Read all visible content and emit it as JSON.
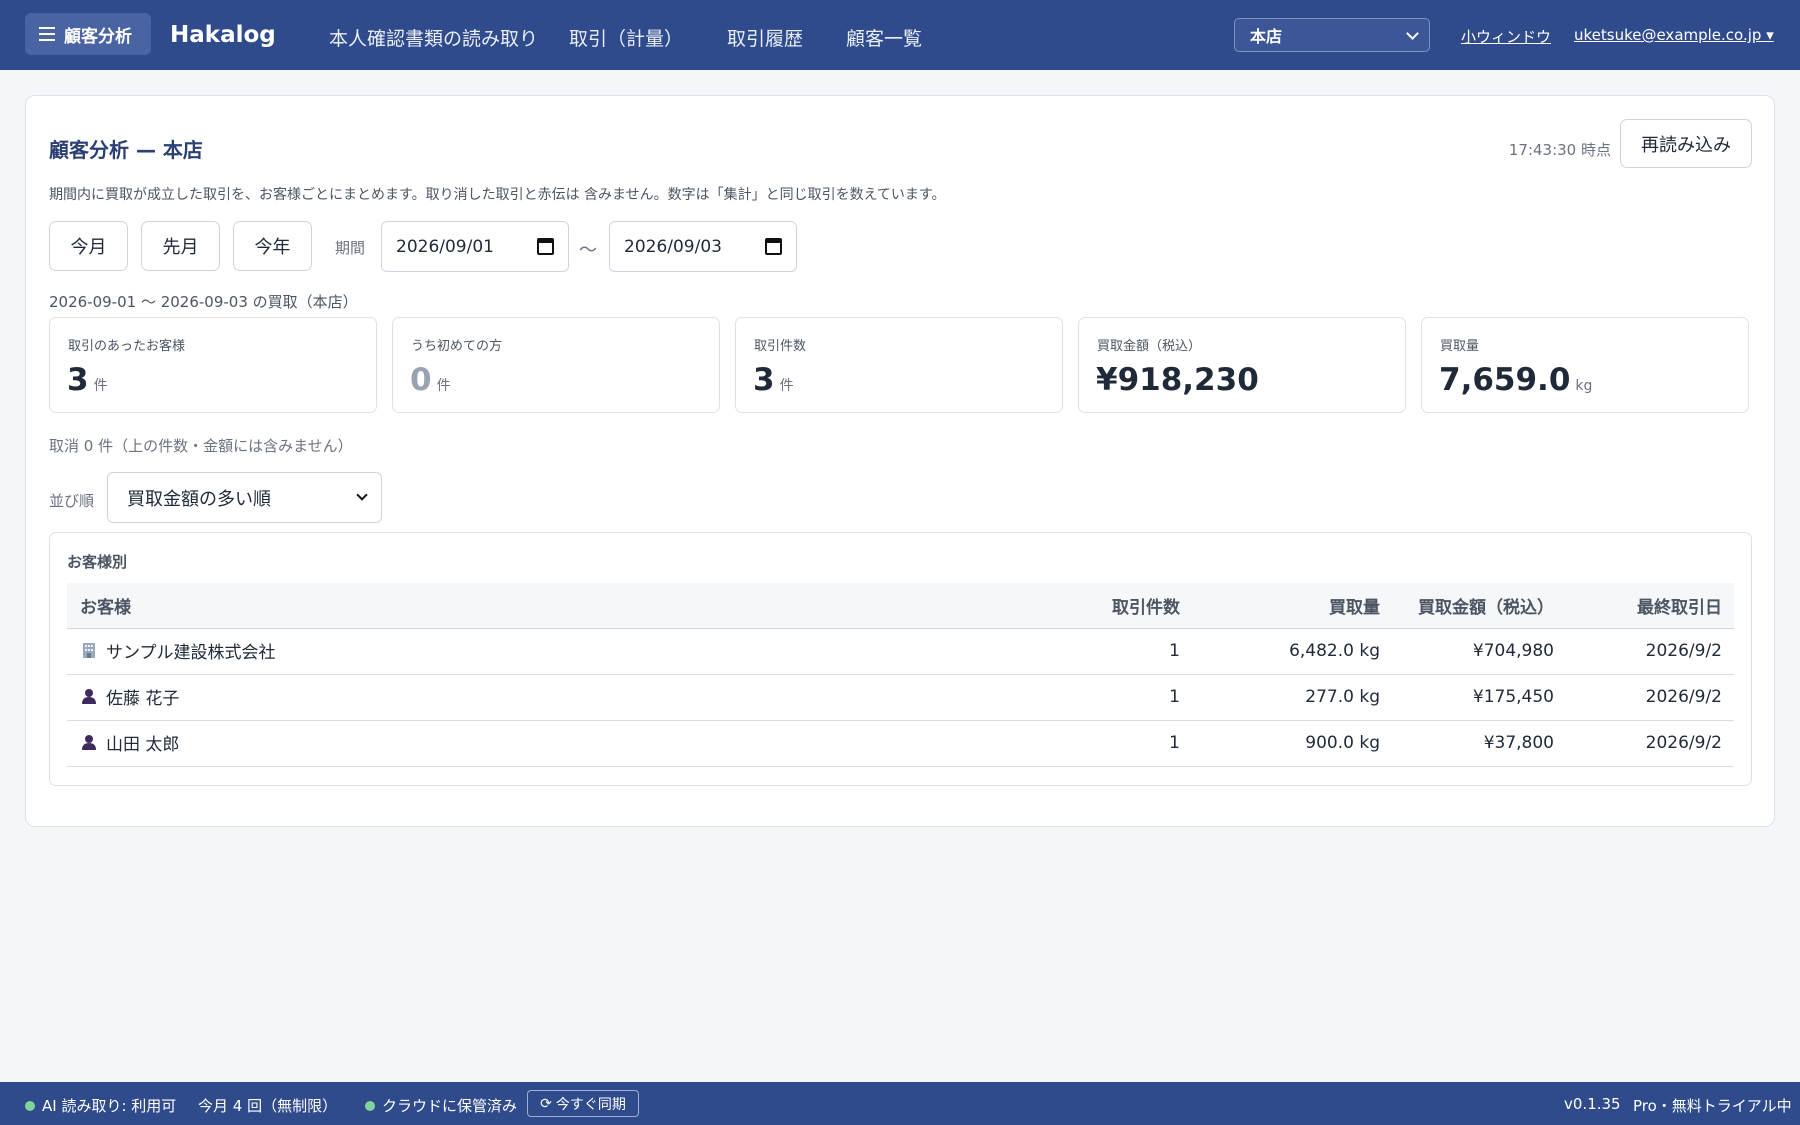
{
  "nav": {
    "menu_label": "顧客分析",
    "brand": "Hakalog",
    "links": [
      "本人確認書類の読み取り",
      "取引（計量）",
      "取引履歴",
      "顧客一覧"
    ],
    "store": "本店",
    "mini_window": "小ウィンドウ",
    "user": "uketsuke@example.co.jp ▾"
  },
  "header": {
    "title": "顧客分析 — 本店",
    "timestamp": "17:43:30 時点",
    "reload": "再読み込み",
    "description": "期間内に買取が成立した取引を、お客様ごとにまとめます。取り消した取引と赤伝は 含みません。数字は「集計」と同じ取引を数えています。"
  },
  "period": {
    "quick": [
      "今月",
      "先月",
      "今年"
    ],
    "label": "期間",
    "from": "2026/09/01",
    "to": "2026/09/03",
    "separator": "〜",
    "caption": "2026-09-01 〜 2026-09-03 の買取（本店）"
  },
  "kpis": [
    {
      "label": "取引のあったお客様",
      "value": "3",
      "unit": "件"
    },
    {
      "label": "うち初めての方",
      "value": "0",
      "unit": "件"
    },
    {
      "label": "取引件数",
      "value": "3",
      "unit": "件"
    },
    {
      "label": "買取金額（税込）",
      "value": "¥918,230",
      "unit": ""
    },
    {
      "label": "買取量",
      "value": "7,659.0",
      "unit": "kg"
    }
  ],
  "cancel_note": "取消 0 件（上の件数・金額には含みません）",
  "sort": {
    "label": "並び順",
    "value": "買取金額の多い順"
  },
  "table": {
    "title": "お客様別",
    "headers": [
      "お客様",
      "取引件数",
      "買取量",
      "買取金額（税込）",
      "最終取引日"
    ],
    "rows": [
      {
        "icon": "building-icon",
        "name": "サンプル建設株式会社",
        "count": "1",
        "weight": "6,482.0 kg",
        "amount": "¥704,980",
        "last": "2026/9/2"
      },
      {
        "icon": "person-icon",
        "name": "佐藤 花子",
        "count": "1",
        "weight": "277.0 kg",
        "amount": "¥175,450",
        "last": "2026/9/2"
      },
      {
        "icon": "person-icon",
        "name": "山田 太郎",
        "count": "1",
        "weight": "900.0 kg",
        "amount": "¥37,800",
        "last": "2026/9/2"
      }
    ]
  },
  "status": {
    "ai": "AI 読み取り: 利用可",
    "monthly": "今月 4 回（無制限）",
    "cloud": "クラウドに保管済み",
    "sync": "今すぐ同期",
    "version": "v0.1.35",
    "plan": "Pro・無料トライアル中"
  }
}
